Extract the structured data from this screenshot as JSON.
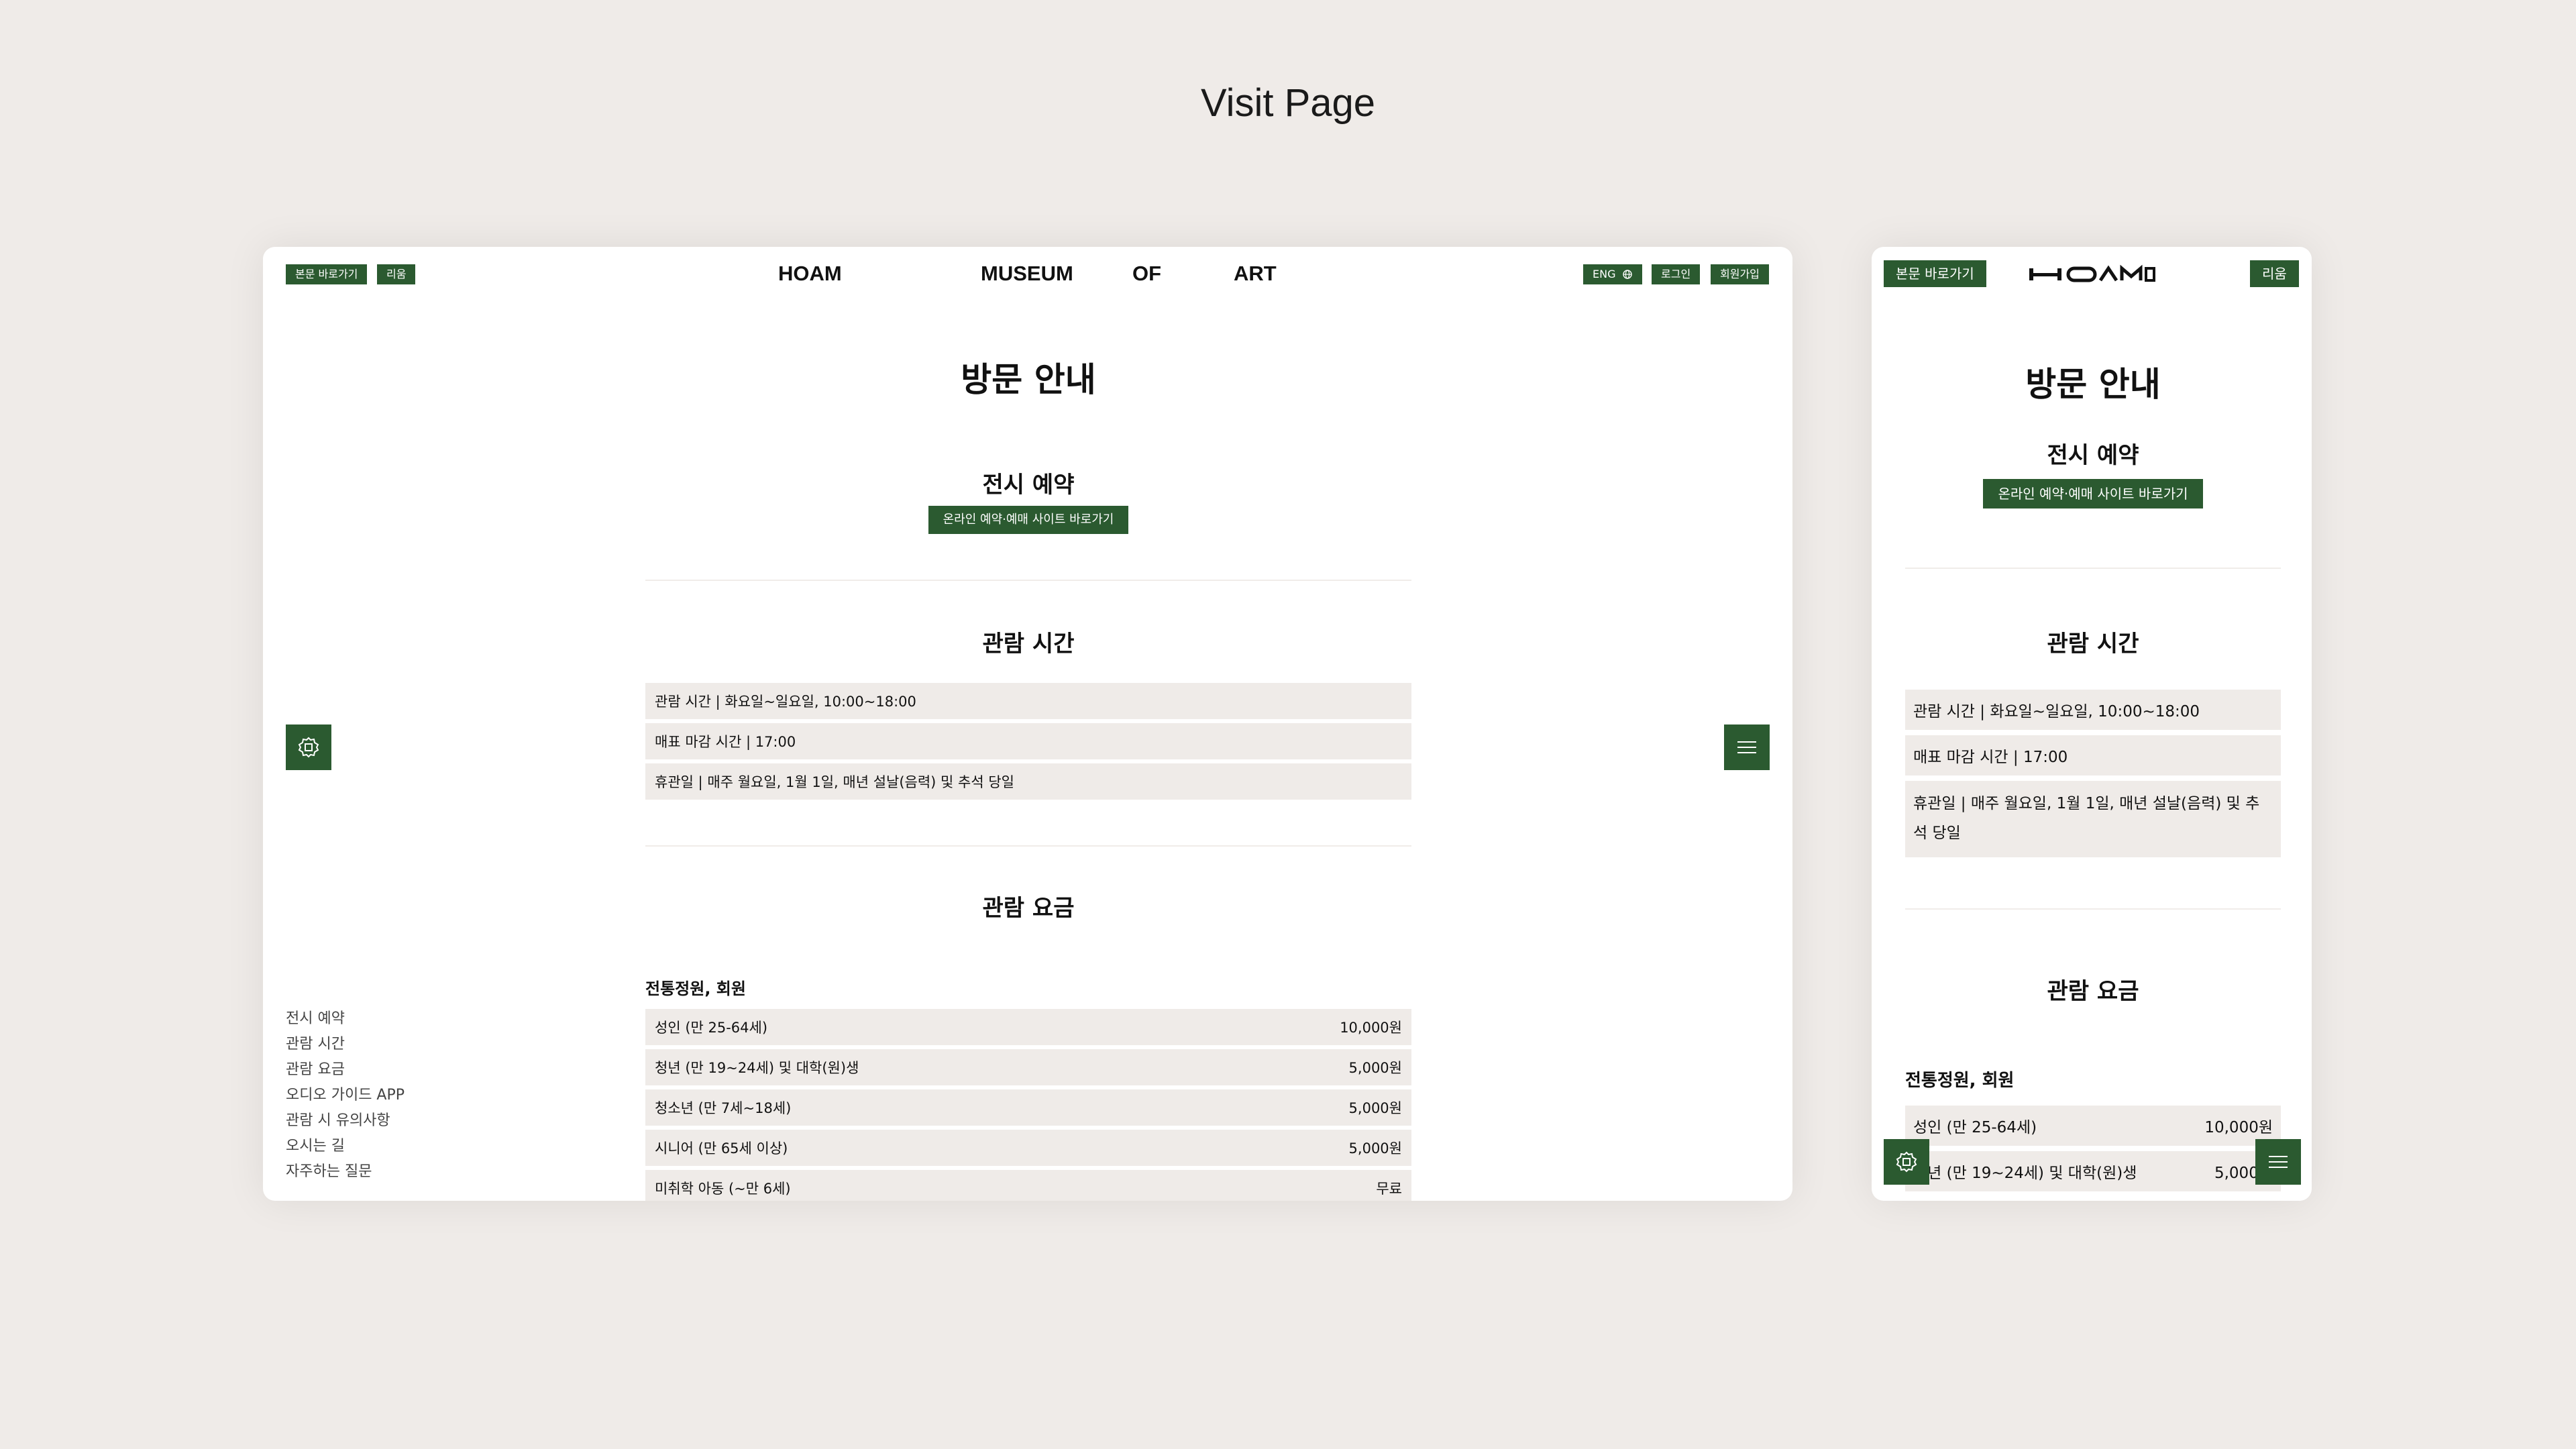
{
  "page_title": "Visit Page",
  "colors": {
    "accent": "#2b5a30",
    "background": "#efebe8",
    "row_bg": "#efebe8"
  },
  "desktop": {
    "header": {
      "skip_link": "본문 바로가기",
      "leeum_button": "리움",
      "logo_words": [
        "HOAM",
        "MUSEUM",
        "OF",
        "ART"
      ],
      "lang_button": "ENG",
      "login_button": "로그인",
      "signup_button": "회원가입"
    },
    "main_title": "방문 안내",
    "reservation": {
      "heading": "전시 예약",
      "button": "온라인 예약·예매 사이트 바로가기"
    },
    "hours": {
      "heading": "관람 시간",
      "rows": [
        "관람 시간 | 화요일~일요일, 10:00~18:00",
        "매표 마감 시간 | 17:00",
        "휴관일 | 매주 월요일, 1월 1일, 매년 설날(음력) 및 추석 당일"
      ]
    },
    "fees": {
      "heading": "관람 요금",
      "group_label": "전통정원, 회원",
      "rows": [
        {
          "label": "성인 (만 25-64세)",
          "price": "10,000원"
        },
        {
          "label": "청년 (만 19~24세) 및 대학(원)생",
          "price": "5,000원"
        },
        {
          "label": "청소년 (만 7세~18세)",
          "price": "5,000원"
        },
        {
          "label": "시니어 (만 65세 이상)",
          "price": "5,000원"
        },
        {
          "label": "미취학 아동 (~만 6세)",
          "price": "무료"
        }
      ]
    },
    "side_nav": [
      "전시 예약",
      "관람 시간",
      "관람 요금",
      "오디오 가이드 APP",
      "관람 시 유의사항",
      "오시는 길",
      "자주하는 질문"
    ]
  },
  "mobile": {
    "header": {
      "skip_link": "본문 바로가기",
      "leeum_button": "리움"
    },
    "main_title": "방문 안내",
    "reservation": {
      "heading": "전시 예약",
      "button": "온라인 예약·예매 사이트 바로가기"
    },
    "hours": {
      "heading": "관람 시간",
      "rows": [
        "관람 시간 | 화요일~일요일, 10:00~18:00",
        "매표 마감 시간 | 17:00",
        "휴관일 | 매주 월요일, 1월 1일, 매년 설날(음력) 및 추석 당일"
      ]
    },
    "fees": {
      "heading": "관람 요금",
      "group_label": "전통정원, 회원",
      "rows": [
        {
          "label": "성인 (만 25-64세)",
          "price": "10,000원"
        },
        {
          "label": "청년 (만 19~24세) 및 대학(원)생",
          "price": "5,000원"
        }
      ]
    }
  }
}
